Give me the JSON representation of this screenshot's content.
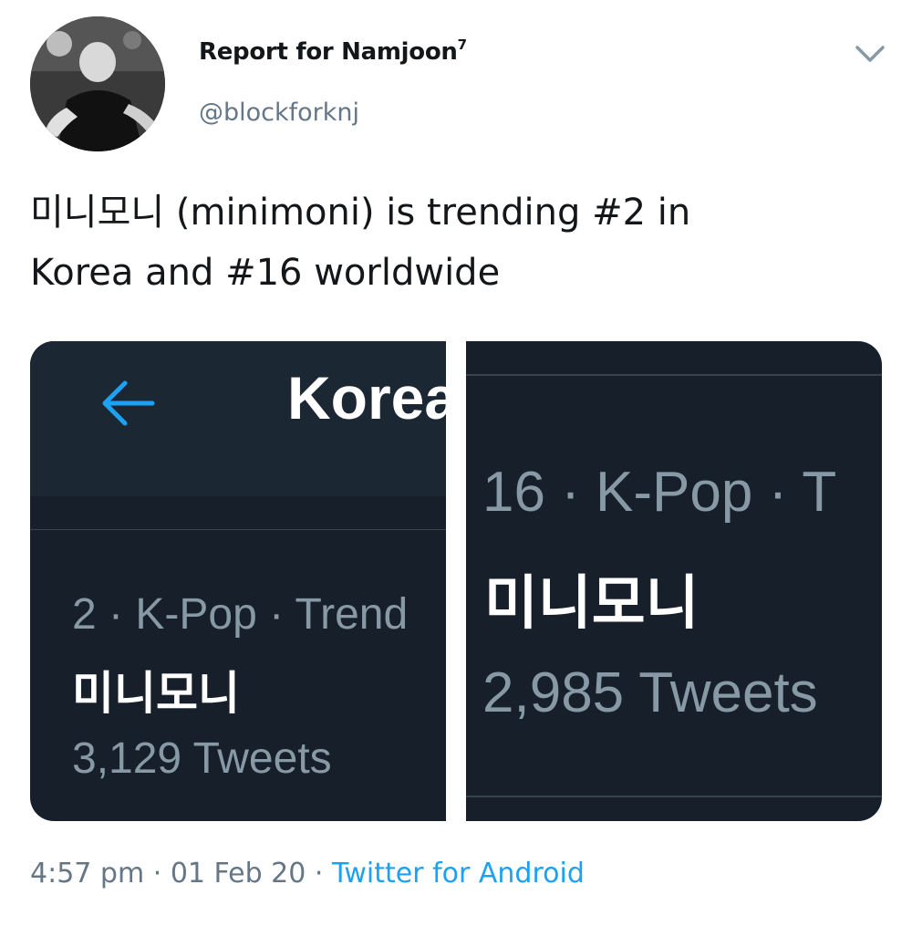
{
  "author": {
    "display_name": "Report for Namjoon",
    "display_name_suffix": "7",
    "handle": "@blockforknj"
  },
  "tweet": {
    "text_line1": "미니모니 (minimoni) is trending #2 in",
    "text_line2": "Korea and #16 worldwide"
  },
  "media": {
    "left": {
      "title": "Korea",
      "trend_meta": "2 · K-Pop · Trend",
      "trend_name": "미니모니",
      "trend_count": "3,129 Tweets"
    },
    "right": {
      "trend_meta": "16 · K-Pop · T",
      "trend_name": "미니모니",
      "trend_count": "2,985 Tweets"
    }
  },
  "footer": {
    "time": "4:57 pm",
    "date": "01 Feb 20",
    "separator": "·",
    "source": "Twitter for Android"
  },
  "colors": {
    "accent": "#1da1f2",
    "dark_bg": "#17202a",
    "secondary_text": "#657786"
  },
  "icons": {
    "menu": "chevron-down-icon",
    "back": "back-arrow-icon"
  }
}
